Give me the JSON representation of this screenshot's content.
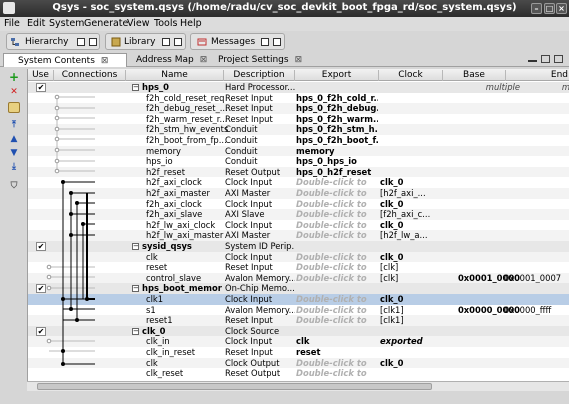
{
  "window": {
    "title": "Qsys - soc_system.qsys (/home/radu/cv_soc_devkit_boot_fpga_rd/soc_system.qsys)"
  },
  "menu": {
    "file": "File",
    "edit": "Edit",
    "system": "System",
    "generate": "Generate",
    "view": "View",
    "tools": "Tools",
    "help": "Help"
  },
  "toolbar": {
    "hierarchy": "Hierarchy",
    "library": "Library",
    "messages": "Messages"
  },
  "tabs": {
    "system_contents": "System Contents",
    "address_map": "Address Map",
    "project_settings": "Project Settings"
  },
  "columns": {
    "use": "Use",
    "connections": "Connections",
    "name": "Name",
    "description": "Description",
    "export": "Export",
    "clock": "Clock",
    "base": "Base",
    "end": "End"
  },
  "rows": [
    {
      "kind": "group",
      "name": "hps_0",
      "description": "Hard Processor...",
      "export": "",
      "clock": "",
      "base": "multiple",
      "end": "m"
    },
    {
      "kind": "child",
      "name": "f2h_cold_reset_req",
      "description": "Reset Input",
      "export": "hps_0_f2h_cold_r...",
      "clock": "",
      "base": "",
      "end": ""
    },
    {
      "kind": "child",
      "name": "f2h_debug_reset_...",
      "description": "Reset Input",
      "export": "hps_0_f2h_debug...",
      "clock": "",
      "base": "",
      "end": ""
    },
    {
      "kind": "child",
      "name": "f2h_warm_reset_r...",
      "description": "Reset Input",
      "export": "hps_0_f2h_warm...",
      "clock": "",
      "base": "",
      "end": ""
    },
    {
      "kind": "child",
      "name": "f2h_stm_hw_events",
      "description": "Conduit",
      "export": "hps_0_f2h_stm_h...",
      "clock": "",
      "base": "",
      "end": ""
    },
    {
      "kind": "child",
      "name": "f2h_boot_from_fp...",
      "description": "Conduit",
      "export": "hps_0_f2h_boot_f...",
      "clock": "",
      "base": "",
      "end": ""
    },
    {
      "kind": "child",
      "name": "memory",
      "description": "Conduit",
      "export": "memory",
      "clock": "",
      "base": "",
      "end": ""
    },
    {
      "kind": "child",
      "name": "hps_io",
      "description": "Conduit",
      "export": "hps_0_hps_io",
      "clock": "",
      "base": "",
      "end": ""
    },
    {
      "kind": "child",
      "name": "h2f_reset",
      "description": "Reset Output",
      "export": "hps_0_h2f_reset",
      "clock": "",
      "base": "",
      "end": ""
    },
    {
      "kind": "child",
      "name": "h2f_axi_clock",
      "description": "Clock Input",
      "export": "Double-click to",
      "clock": "clk_0",
      "base": "",
      "end": ""
    },
    {
      "kind": "child",
      "name": "h2f_axi_master",
      "description": "AXI Master",
      "export": "Double-click to",
      "clock": "[h2f_axi_...",
      "base": "",
      "end": ""
    },
    {
      "kind": "child",
      "name": "f2h_axi_clock",
      "description": "Clock Input",
      "export": "Double-click to",
      "clock": "clk_0",
      "base": "",
      "end": ""
    },
    {
      "kind": "child",
      "name": "f2h_axi_slave",
      "description": "AXI Slave",
      "export": "Double-click to",
      "clock": "[f2h_axi_c...",
      "base": "",
      "end": ""
    },
    {
      "kind": "child",
      "name": "h2f_lw_axi_clock",
      "description": "Clock Input",
      "export": "Double-click to",
      "clock": "clk_0",
      "base": "",
      "end": ""
    },
    {
      "kind": "child",
      "name": "h2f_lw_axi_master",
      "description": "AXI Master",
      "export": "Double-click to",
      "clock": "[h2f_lw_a...",
      "base": "",
      "end": ""
    },
    {
      "kind": "group",
      "name": "sysid_qsys",
      "description": "System ID Perip...",
      "export": "",
      "clock": "",
      "base": "",
      "end": ""
    },
    {
      "kind": "child",
      "name": "clk",
      "description": "Clock Input",
      "export": "Double-click to",
      "clock": "clk_0",
      "base": "",
      "end": ""
    },
    {
      "kind": "child",
      "name": "reset",
      "description": "Reset Input",
      "export": "Double-click to",
      "clock": "[clk]",
      "base": "",
      "end": ""
    },
    {
      "kind": "child",
      "name": "control_slave",
      "description": "Avalon Memory...",
      "export": "Double-click to",
      "clock": "[clk]",
      "base": "0x0001_0000",
      "end": "0x0001_0007"
    },
    {
      "kind": "group",
      "name": "hps_boot_memory",
      "description": "On-Chip Memo...",
      "export": "",
      "clock": "",
      "base": "",
      "end": ""
    },
    {
      "kind": "child",
      "name": "clk1",
      "description": "Clock Input",
      "export": "Double-click to",
      "clock": "clk_0",
      "base": "",
      "end": ""
    },
    {
      "kind": "child",
      "name": "s1",
      "description": "Avalon Memory...",
      "export": "Double-click to",
      "clock": "[clk1]",
      "base": "0x0000_0000",
      "end": "0x0000_ffff"
    },
    {
      "kind": "child",
      "name": "reset1",
      "description": "Reset Input",
      "export": "Double-click to",
      "clock": "[clk1]",
      "base": "",
      "end": ""
    },
    {
      "kind": "group",
      "name": "clk_0",
      "description": "Clock Source",
      "export": "",
      "clock": "",
      "base": "",
      "end": ""
    },
    {
      "kind": "child",
      "name": "clk_in",
      "description": "Clock Input",
      "export": "clk",
      "clock": "exported",
      "base": "",
      "end": ""
    },
    {
      "kind": "child",
      "name": "clk_in_reset",
      "description": "Reset Input",
      "export": "reset",
      "clock": "",
      "base": "",
      "end": ""
    },
    {
      "kind": "child",
      "name": "clk",
      "description": "Clock Output",
      "export": "Double-click to",
      "clock": "clk_0",
      "base": "",
      "end": ""
    },
    {
      "kind": "child",
      "name": "clk_reset",
      "description": "Reset Output",
      "export": "Double-click to",
      "clock": "",
      "base": "",
      "end": ""
    }
  ]
}
